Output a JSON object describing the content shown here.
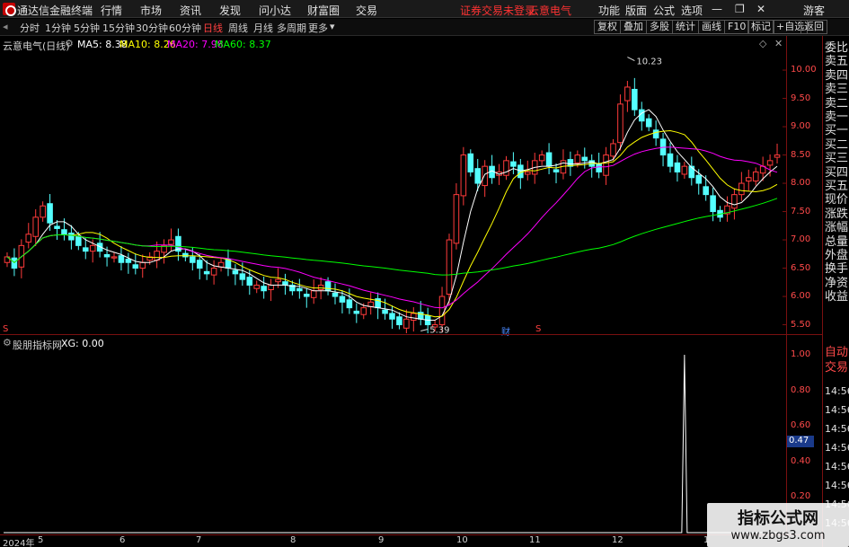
{
  "menubar": {
    "app_title": "通达信金融终端",
    "items": [
      "行情",
      "市场",
      "资讯",
      "发现",
      "问小达",
      "财富圈",
      "交易"
    ],
    "notice": "证券交易未登录",
    "stock_name_tag": "云意电气",
    "right_items": [
      "功能",
      "版面",
      "公式",
      "选项"
    ],
    "user": "游客"
  },
  "toolbar": {
    "periods": [
      "分时",
      "1分钟",
      "5分钟",
      "15分钟",
      "30分钟",
      "60分钟",
      "日线",
      "周线",
      "月线",
      "多周期",
      "更多"
    ],
    "active_period": "日线",
    "right_buttons": [
      "复权",
      "叠加",
      "多股",
      "统计",
      "画线",
      "F10",
      "标记",
      "+自选",
      "返回"
    ]
  },
  "main_chart": {
    "title": "云意电气(日线)",
    "ma5": "MA5: 8.38",
    "ma10": "MA10: 8.26",
    "ma20": "MA20: 7.98",
    "ma60": "MA60: 8.37",
    "high_label": "10.23",
    "low_label": "5.39",
    "event_marks": [
      "S",
      "财",
      "S"
    ]
  },
  "indicator": {
    "title": "股朋指标网",
    "xg": "XG: 0.00",
    "current_value": "0.47"
  },
  "order_book": {
    "labels": [
      "委比",
      "卖五",
      "卖四",
      "卖三",
      "卖二",
      "卖一",
      "买一",
      "买二",
      "买三",
      "买四",
      "买五",
      "现价",
      "涨跌",
      "涨幅",
      "总量",
      "外盘",
      "换手",
      "净资",
      "收益"
    ],
    "auto_trade": [
      "自动",
      "交易"
    ],
    "times": [
      "14:56",
      "14:56",
      "14:56",
      "14:56",
      "14:56",
      "14:56",
      "14:56",
      "14:56"
    ]
  },
  "chart_data": [
    {
      "type": "candlestick",
      "title": "云意电气(日线)",
      "x_tick_labels": [
        "2024年",
        "5",
        "6",
        "7",
        "8",
        "9",
        "10",
        "11",
        "12",
        "1"
      ],
      "y_tick_labels": [
        "10.00",
        "9.50",
        "9.00",
        "8.50",
        "8.00",
        "7.50",
        "7.00",
        "6.50",
        "6.00",
        "5.50"
      ],
      "ylim": [
        5.35,
        10.35
      ],
      "series": [
        {
          "name": "MA5",
          "color": "#ffffff",
          "last": 8.38
        },
        {
          "name": "MA10",
          "color": "#ffff00",
          "last": 8.26
        },
        {
          "name": "MA20",
          "color": "#ff00ff",
          "last": 7.98
        },
        {
          "name": "MA60",
          "color": "#00ff00",
          "last": 8.37
        }
      ],
      "annotations": {
        "high": 10.23,
        "low": 5.39
      },
      "close_prices": [
        6.7,
        6.5,
        6.9,
        7.1,
        7.4,
        7.6,
        7.3,
        7.2,
        7.1,
        7.0,
        6.9,
        6.8,
        6.9,
        6.8,
        6.7,
        6.7,
        6.6,
        6.6,
        6.5,
        6.6,
        6.7,
        6.8,
        6.9,
        7.0,
        6.8,
        6.7,
        6.6,
        6.5,
        6.4,
        6.5,
        6.6,
        6.5,
        6.4,
        6.3,
        6.2,
        6.2,
        6.1,
        6.2,
        6.3,
        6.2,
        6.1,
        6.1,
        6.0,
        6.1,
        6.2,
        6.1,
        6.0,
        5.9,
        5.8,
        5.7,
        5.8,
        5.9,
        5.8,
        5.7,
        5.6,
        5.5,
        5.6,
        5.7,
        5.6,
        5.5,
        5.5,
        6.0,
        7.0,
        7.8,
        8.5,
        8.2,
        8.0,
        8.3,
        8.1,
        8.2,
        8.4,
        8.3,
        8.1,
        8.2,
        8.4,
        8.5,
        8.3,
        8.2,
        8.4,
        8.3,
        8.5,
        8.4,
        8.3,
        8.2,
        8.5,
        8.7,
        9.4,
        9.7,
        9.3,
        9.1,
        9.0,
        8.8,
        8.5,
        8.3,
        8.2,
        8.3,
        8.1,
        8.0,
        7.8,
        7.5,
        7.4,
        7.6,
        7.8,
        8.0,
        8.1,
        8.2,
        8.3,
        8.4,
        8.5
      ]
    },
    {
      "type": "line",
      "title": "股朋指标网",
      "y_tick_labels": [
        "1.00",
        "0.80",
        "0.60",
        "0.40",
        "0.20"
      ],
      "ylim": [
        0,
        1.0
      ],
      "series": [
        {
          "name": "XG",
          "spike_index": 95,
          "spike_value": 1.0,
          "last": 0.0
        }
      ]
    }
  ],
  "watermark": {
    "line1": "指标公式网",
    "line2": "www.zbgs3.com"
  }
}
